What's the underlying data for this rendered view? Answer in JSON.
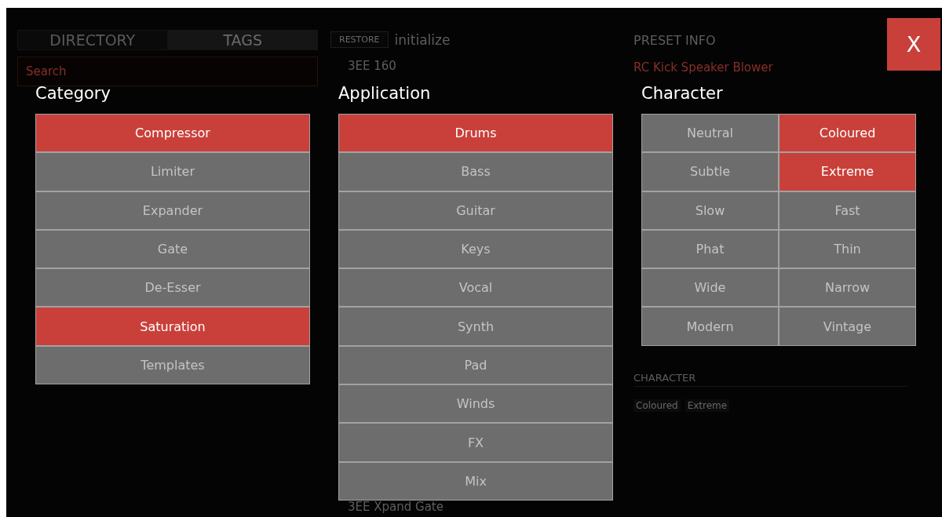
{
  "background": {
    "tabs": [
      {
        "label": "DIRECTORY",
        "selected": false
      },
      {
        "label": "TAGS",
        "selected": true
      }
    ],
    "search": {
      "placeholder": "Search"
    },
    "restore_button": "RESTORE",
    "preset_name": "initialize",
    "preset_list": [
      "3EE 160",
      "3EE Xpand Gate"
    ],
    "preset_info": {
      "title": "PRESET INFO",
      "name": "RC Kick Speaker Blower",
      "section_title": "CHARACTER",
      "tags": [
        "Coloured",
        "Extreme"
      ]
    }
  },
  "close_button": "X",
  "pickers": [
    {
      "title": "Category",
      "kind": "list",
      "items": [
        {
          "label": "Compressor",
          "selected": true
        },
        {
          "label": "Limiter",
          "selected": false
        },
        {
          "label": "Expander",
          "selected": false
        },
        {
          "label": "Gate",
          "selected": false
        },
        {
          "label": "De-Esser",
          "selected": false
        },
        {
          "label": "Saturation",
          "selected": true
        },
        {
          "label": "Templates",
          "selected": false
        }
      ]
    },
    {
      "title": "Application",
      "kind": "list",
      "items": [
        {
          "label": "Drums",
          "selected": true
        },
        {
          "label": "Bass",
          "selected": false
        },
        {
          "label": "Guitar",
          "selected": false
        },
        {
          "label": "Keys",
          "selected": false
        },
        {
          "label": "Vocal",
          "selected": false
        },
        {
          "label": "Synth",
          "selected": false
        },
        {
          "label": "Pad",
          "selected": false
        },
        {
          "label": "Winds",
          "selected": false
        },
        {
          "label": "FX",
          "selected": false
        },
        {
          "label": "Mix",
          "selected": false
        }
      ]
    },
    {
      "title": "Character",
      "kind": "grid",
      "items": [
        {
          "label": "Neutral",
          "selected": false
        },
        {
          "label": "Coloured",
          "selected": true
        },
        {
          "label": "Subtle",
          "selected": false
        },
        {
          "label": "Extreme",
          "selected": true
        },
        {
          "label": "Slow",
          "selected": false
        },
        {
          "label": "Fast",
          "selected": false
        },
        {
          "label": "Phat",
          "selected": false
        },
        {
          "label": "Thin",
          "selected": false
        },
        {
          "label": "Wide",
          "selected": false
        },
        {
          "label": "Narrow",
          "selected": false
        },
        {
          "label": "Modern",
          "selected": false
        },
        {
          "label": "Vintage",
          "selected": false
        }
      ]
    }
  ]
}
